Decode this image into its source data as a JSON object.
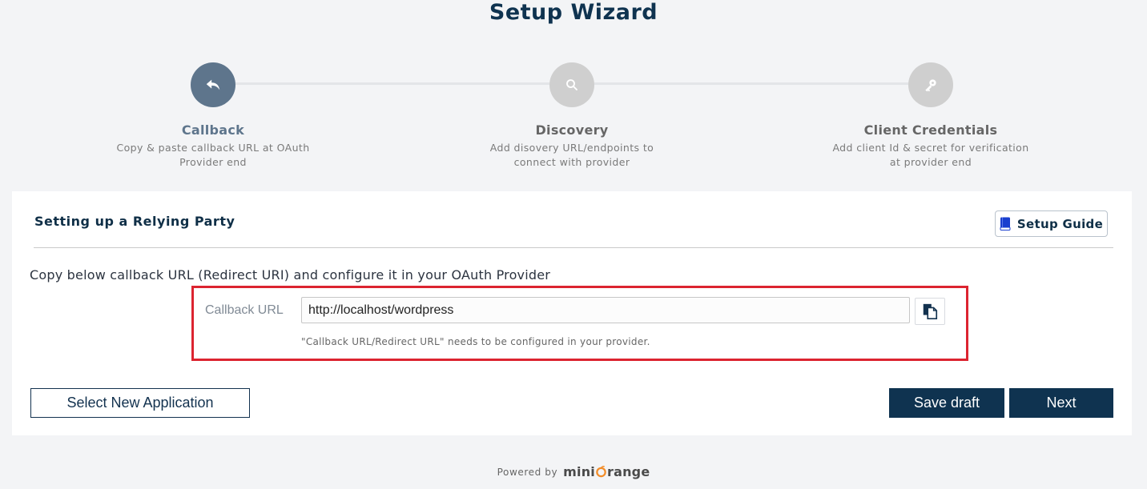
{
  "page": {
    "title": "Setup Wizard"
  },
  "steps": [
    {
      "title": "Callback",
      "description": "Copy & paste callback URL at OAuth Provider end",
      "icon": "reply-icon",
      "active": true
    },
    {
      "title": "Discovery",
      "description": "Add disovery URL/endpoints to connect with provider",
      "icon": "search-icon",
      "active": false
    },
    {
      "title": "Client Credentials",
      "description": "Add client Id & secret for verification at provider end",
      "icon": "key-icon",
      "active": false
    }
  ],
  "card": {
    "heading": "Setting up a Relying Party",
    "guide_button": "Setup Guide",
    "instruction": "Copy below callback URL (Redirect URI) and configure it in your OAuth Provider",
    "callback_label": "Callback URL",
    "callback_value": "http://localhost/wordpress",
    "callback_help": "\"Callback URL/Redirect URL\" needs to be configured in your provider."
  },
  "actions": {
    "select_new": "Select New Application",
    "save_draft": "Save draft",
    "next": "Next"
  },
  "footer": {
    "powered_by": "Powered by",
    "brand_left": "mini",
    "brand_right": "range"
  },
  "colors": {
    "primary": "#0f3350",
    "active_step": "#5e758c",
    "inactive_step": "#cfcfcf",
    "highlight": "#dc2430",
    "brand_orange": "#f28c28"
  }
}
